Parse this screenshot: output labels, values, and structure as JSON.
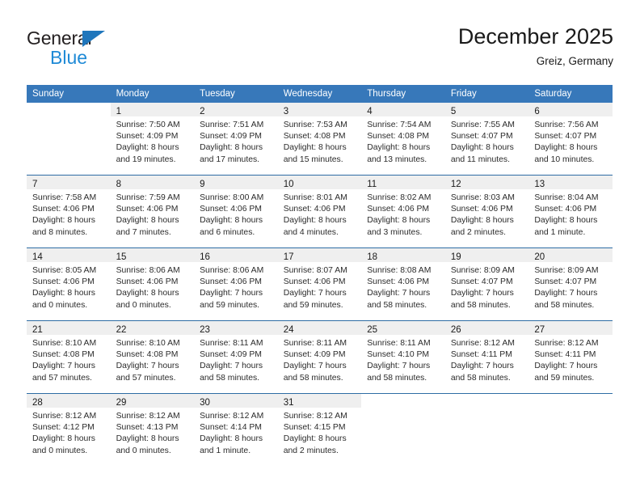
{
  "brand": {
    "name_top": "General",
    "name_bottom": "Blue"
  },
  "header": {
    "title": "December 2025",
    "subtitle": "Greiz, Germany"
  },
  "colors": {
    "header_blue": "#3778ba",
    "row_divider": "#2e6da4",
    "daynum_band": "#efefef",
    "logo_blue": "#1f8ad6",
    "logo_triangle": "#1f76bc"
  },
  "weekdays": [
    "Sunday",
    "Monday",
    "Tuesday",
    "Wednesday",
    "Thursday",
    "Friday",
    "Saturday"
  ],
  "weeks": [
    [
      {
        "day": "",
        "sunrise": "",
        "sunset": "",
        "daylight1": "",
        "daylight2": ""
      },
      {
        "day": "1",
        "sunrise": "Sunrise: 7:50 AM",
        "sunset": "Sunset: 4:09 PM",
        "daylight1": "Daylight: 8 hours",
        "daylight2": "and 19 minutes."
      },
      {
        "day": "2",
        "sunrise": "Sunrise: 7:51 AM",
        "sunset": "Sunset: 4:09 PM",
        "daylight1": "Daylight: 8 hours",
        "daylight2": "and 17 minutes."
      },
      {
        "day": "3",
        "sunrise": "Sunrise: 7:53 AM",
        "sunset": "Sunset: 4:08 PM",
        "daylight1": "Daylight: 8 hours",
        "daylight2": "and 15 minutes."
      },
      {
        "day": "4",
        "sunrise": "Sunrise: 7:54 AM",
        "sunset": "Sunset: 4:08 PM",
        "daylight1": "Daylight: 8 hours",
        "daylight2": "and 13 minutes."
      },
      {
        "day": "5",
        "sunrise": "Sunrise: 7:55 AM",
        "sunset": "Sunset: 4:07 PM",
        "daylight1": "Daylight: 8 hours",
        "daylight2": "and 11 minutes."
      },
      {
        "day": "6",
        "sunrise": "Sunrise: 7:56 AM",
        "sunset": "Sunset: 4:07 PM",
        "daylight1": "Daylight: 8 hours",
        "daylight2": "and 10 minutes."
      }
    ],
    [
      {
        "day": "7",
        "sunrise": "Sunrise: 7:58 AM",
        "sunset": "Sunset: 4:06 PM",
        "daylight1": "Daylight: 8 hours",
        "daylight2": "and 8 minutes."
      },
      {
        "day": "8",
        "sunrise": "Sunrise: 7:59 AM",
        "sunset": "Sunset: 4:06 PM",
        "daylight1": "Daylight: 8 hours",
        "daylight2": "and 7 minutes."
      },
      {
        "day": "9",
        "sunrise": "Sunrise: 8:00 AM",
        "sunset": "Sunset: 4:06 PM",
        "daylight1": "Daylight: 8 hours",
        "daylight2": "and 6 minutes."
      },
      {
        "day": "10",
        "sunrise": "Sunrise: 8:01 AM",
        "sunset": "Sunset: 4:06 PM",
        "daylight1": "Daylight: 8 hours",
        "daylight2": "and 4 minutes."
      },
      {
        "day": "11",
        "sunrise": "Sunrise: 8:02 AM",
        "sunset": "Sunset: 4:06 PM",
        "daylight1": "Daylight: 8 hours",
        "daylight2": "and 3 minutes."
      },
      {
        "day": "12",
        "sunrise": "Sunrise: 8:03 AM",
        "sunset": "Sunset: 4:06 PM",
        "daylight1": "Daylight: 8 hours",
        "daylight2": "and 2 minutes."
      },
      {
        "day": "13",
        "sunrise": "Sunrise: 8:04 AM",
        "sunset": "Sunset: 4:06 PM",
        "daylight1": "Daylight: 8 hours",
        "daylight2": "and 1 minute."
      }
    ],
    [
      {
        "day": "14",
        "sunrise": "Sunrise: 8:05 AM",
        "sunset": "Sunset: 4:06 PM",
        "daylight1": "Daylight: 8 hours",
        "daylight2": "and 0 minutes."
      },
      {
        "day": "15",
        "sunrise": "Sunrise: 8:06 AM",
        "sunset": "Sunset: 4:06 PM",
        "daylight1": "Daylight: 8 hours",
        "daylight2": "and 0 minutes."
      },
      {
        "day": "16",
        "sunrise": "Sunrise: 8:06 AM",
        "sunset": "Sunset: 4:06 PM",
        "daylight1": "Daylight: 7 hours",
        "daylight2": "and 59 minutes."
      },
      {
        "day": "17",
        "sunrise": "Sunrise: 8:07 AM",
        "sunset": "Sunset: 4:06 PM",
        "daylight1": "Daylight: 7 hours",
        "daylight2": "and 59 minutes."
      },
      {
        "day": "18",
        "sunrise": "Sunrise: 8:08 AM",
        "sunset": "Sunset: 4:06 PM",
        "daylight1": "Daylight: 7 hours",
        "daylight2": "and 58 minutes."
      },
      {
        "day": "19",
        "sunrise": "Sunrise: 8:09 AM",
        "sunset": "Sunset: 4:07 PM",
        "daylight1": "Daylight: 7 hours",
        "daylight2": "and 58 minutes."
      },
      {
        "day": "20",
        "sunrise": "Sunrise: 8:09 AM",
        "sunset": "Sunset: 4:07 PM",
        "daylight1": "Daylight: 7 hours",
        "daylight2": "and 58 minutes."
      }
    ],
    [
      {
        "day": "21",
        "sunrise": "Sunrise: 8:10 AM",
        "sunset": "Sunset: 4:08 PM",
        "daylight1": "Daylight: 7 hours",
        "daylight2": "and 57 minutes."
      },
      {
        "day": "22",
        "sunrise": "Sunrise: 8:10 AM",
        "sunset": "Sunset: 4:08 PM",
        "daylight1": "Daylight: 7 hours",
        "daylight2": "and 57 minutes."
      },
      {
        "day": "23",
        "sunrise": "Sunrise: 8:11 AM",
        "sunset": "Sunset: 4:09 PM",
        "daylight1": "Daylight: 7 hours",
        "daylight2": "and 58 minutes."
      },
      {
        "day": "24",
        "sunrise": "Sunrise: 8:11 AM",
        "sunset": "Sunset: 4:09 PM",
        "daylight1": "Daylight: 7 hours",
        "daylight2": "and 58 minutes."
      },
      {
        "day": "25",
        "sunrise": "Sunrise: 8:11 AM",
        "sunset": "Sunset: 4:10 PM",
        "daylight1": "Daylight: 7 hours",
        "daylight2": "and 58 minutes."
      },
      {
        "day": "26",
        "sunrise": "Sunrise: 8:12 AM",
        "sunset": "Sunset: 4:11 PM",
        "daylight1": "Daylight: 7 hours",
        "daylight2": "and 58 minutes."
      },
      {
        "day": "27",
        "sunrise": "Sunrise: 8:12 AM",
        "sunset": "Sunset: 4:11 PM",
        "daylight1": "Daylight: 7 hours",
        "daylight2": "and 59 minutes."
      }
    ],
    [
      {
        "day": "28",
        "sunrise": "Sunrise: 8:12 AM",
        "sunset": "Sunset: 4:12 PM",
        "daylight1": "Daylight: 8 hours",
        "daylight2": "and 0 minutes."
      },
      {
        "day": "29",
        "sunrise": "Sunrise: 8:12 AM",
        "sunset": "Sunset: 4:13 PM",
        "daylight1": "Daylight: 8 hours",
        "daylight2": "and 0 minutes."
      },
      {
        "day": "30",
        "sunrise": "Sunrise: 8:12 AM",
        "sunset": "Sunset: 4:14 PM",
        "daylight1": "Daylight: 8 hours",
        "daylight2": "and 1 minute."
      },
      {
        "day": "31",
        "sunrise": "Sunrise: 8:12 AM",
        "sunset": "Sunset: 4:15 PM",
        "daylight1": "Daylight: 8 hours",
        "daylight2": "and 2 minutes."
      },
      {
        "day": "",
        "sunrise": "",
        "sunset": "",
        "daylight1": "",
        "daylight2": ""
      },
      {
        "day": "",
        "sunrise": "",
        "sunset": "",
        "daylight1": "",
        "daylight2": ""
      },
      {
        "day": "",
        "sunrise": "",
        "sunset": "",
        "daylight1": "",
        "daylight2": ""
      }
    ]
  ]
}
